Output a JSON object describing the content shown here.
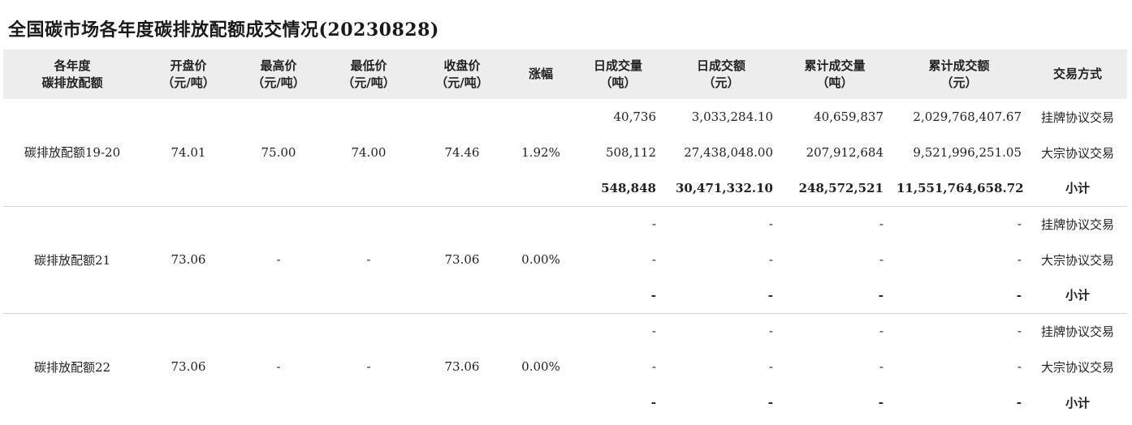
{
  "title": "全国碳市场各年度碳排放配额成交情况(20230828)",
  "headers": [
    [
      "各年度",
      "碳排放配额"
    ],
    [
      "开盘价",
      "（元/吨）"
    ],
    [
      "最高价",
      "（元/吨）"
    ],
    [
      "最低价",
      "（元/吨）"
    ],
    [
      "收盘价",
      "（元/吨）"
    ],
    [
      "涨幅"
    ],
    [
      "日成交量",
      "（吨）"
    ],
    [
      "日成交额",
      "（元）"
    ],
    [
      "累计成交量",
      "（吨）"
    ],
    [
      "累计成交额",
      "（元）"
    ],
    [
      "交易方式"
    ]
  ],
  "groups": [
    {
      "name": "碳排放配额19-20",
      "open": "74.01",
      "high": "75.00",
      "low": "74.00",
      "close": "74.46",
      "change": "1.92%",
      "rows": [
        {
          "daily_volume": "40,736",
          "daily_amount": "3,033,284.10",
          "cum_volume": "40,659,837",
          "cum_amount": "2,029,768,407.67",
          "mode": "挂牌协议交易"
        },
        {
          "daily_volume": "508,112",
          "daily_amount": "27,438,048.00",
          "cum_volume": "207,912,684",
          "cum_amount": "9,521,996,251.05",
          "mode": "大宗协议交易"
        },
        {
          "daily_volume": "548,848",
          "daily_amount": "30,471,332.10",
          "cum_volume": "248,572,521",
          "cum_amount": "11,551,764,658.72",
          "mode": "小计"
        }
      ]
    },
    {
      "name": "碳排放配额21",
      "open": "73.06",
      "high": "-",
      "low": "-",
      "close": "73.06",
      "change": "0.00%",
      "rows": [
        {
          "daily_volume": "-",
          "daily_amount": "-",
          "cum_volume": "-",
          "cum_amount": "-",
          "mode": "挂牌协议交易"
        },
        {
          "daily_volume": "-",
          "daily_amount": "-",
          "cum_volume": "-",
          "cum_amount": "-",
          "mode": "大宗协议交易"
        },
        {
          "daily_volume": "-",
          "daily_amount": "-",
          "cum_volume": "-",
          "cum_amount": "-",
          "mode": "小计"
        }
      ]
    },
    {
      "name": "碳排放配额22",
      "open": "73.06",
      "high": "-",
      "low": "-",
      "close": "73.06",
      "change": "0.00%",
      "rows": [
        {
          "daily_volume": "-",
          "daily_amount": "-",
          "cum_volume": "-",
          "cum_amount": "-",
          "mode": "挂牌协议交易"
        },
        {
          "daily_volume": "-",
          "daily_amount": "-",
          "cum_volume": "-",
          "cum_amount": "-",
          "mode": "大宗协议交易"
        },
        {
          "daily_volume": "-",
          "daily_amount": "-",
          "cum_volume": "-",
          "cum_amount": "-",
          "mode": "小计"
        }
      ]
    }
  ]
}
